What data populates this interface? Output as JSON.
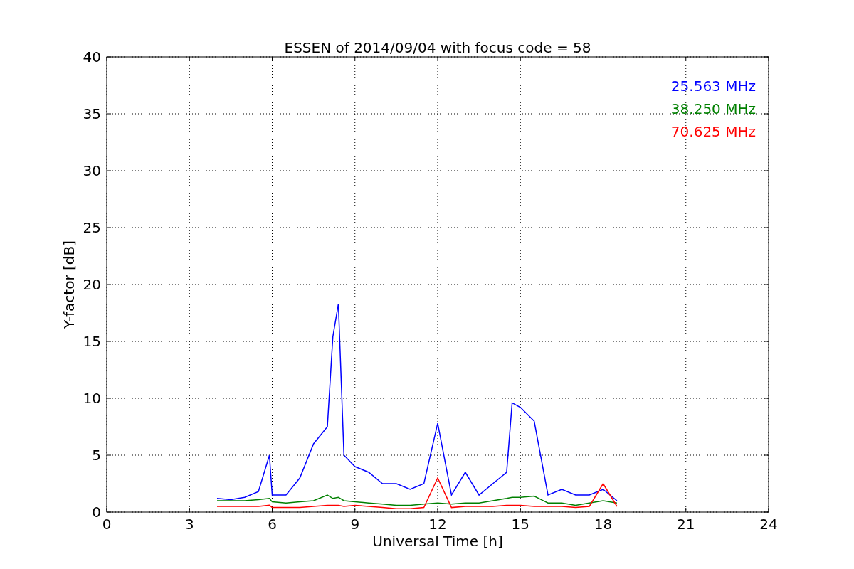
{
  "chart_data": {
    "type": "line",
    "title": "ESSEN of 2014/09/04 with focus code = 58",
    "xlabel": "Universal Time [h]",
    "ylabel": "Y-factor [dB]",
    "x": [
      4,
      4.5,
      5,
      5.5,
      5.9,
      6,
      6.5,
      7,
      7.5,
      8,
      8.2,
      8.4,
      8.6,
      9,
      9.5,
      10,
      10.5,
      11,
      11.5,
      12,
      12.5,
      13,
      13.5,
      14,
      14.5,
      14.7,
      15,
      15.5,
      16,
      16.5,
      17,
      17.5,
      18,
      18.5
    ],
    "series": [
      {
        "name": "25.563 MHz",
        "color": "#0000ff",
        "values": [
          1.2,
          1.1,
          1.3,
          1.8,
          5.0,
          1.5,
          1.5,
          3.0,
          6.0,
          7.5,
          15.4,
          18.3,
          5.0,
          4.0,
          3.5,
          2.5,
          2.5,
          2.0,
          2.5,
          7.8,
          1.5,
          3.5,
          1.5,
          2.5,
          3.5,
          9.6,
          9.2,
          8.0,
          1.5,
          2.0,
          1.5,
          1.5,
          2.0,
          1.0
        ]
      },
      {
        "name": "38.250 MHz",
        "color": "#008000",
        "values": [
          1.0,
          1.0,
          1.0,
          1.1,
          1.2,
          0.9,
          0.8,
          0.9,
          1.0,
          1.5,
          1.2,
          1.3,
          1.0,
          0.9,
          0.8,
          0.7,
          0.6,
          0.6,
          0.7,
          0.8,
          0.7,
          0.8,
          0.8,
          1.0,
          1.2,
          1.3,
          1.3,
          1.4,
          0.8,
          0.8,
          0.6,
          0.8,
          1.0,
          0.8
        ]
      },
      {
        "name": "70.625 MHz",
        "color": "#ff0000",
        "values": [
          0.5,
          0.5,
          0.5,
          0.5,
          0.6,
          0.4,
          0.4,
          0.4,
          0.5,
          0.6,
          0.6,
          0.6,
          0.5,
          0.6,
          0.5,
          0.4,
          0.3,
          0.3,
          0.4,
          3.0,
          0.4,
          0.5,
          0.5,
          0.5,
          0.6,
          0.6,
          0.6,
          0.5,
          0.5,
          0.5,
          0.4,
          0.5,
          2.5,
          0.5
        ]
      }
    ],
    "grid": true,
    "xlim": [
      0,
      24
    ],
    "ylim": [
      0,
      40
    ],
    "xticks": [
      {
        "value": 0,
        "label": "0"
      },
      {
        "value": 3,
        "label": "3"
      },
      {
        "value": 6,
        "label": "6"
      },
      {
        "value": 9,
        "label": "9"
      },
      {
        "value": 12,
        "label": "12"
      },
      {
        "value": 15,
        "label": "15"
      },
      {
        "value": 18,
        "label": "18"
      },
      {
        "value": 21,
        "label": "21"
      },
      {
        "value": 24,
        "label": "24"
      }
    ],
    "yticks": [
      {
        "value": 0,
        "label": "0"
      },
      {
        "value": 5,
        "label": "5"
      },
      {
        "value": 10,
        "label": "10"
      },
      {
        "value": 15,
        "label": "15"
      },
      {
        "value": 20,
        "label": "20"
      },
      {
        "value": 25,
        "label": "25"
      },
      {
        "value": 30,
        "label": "30"
      },
      {
        "value": 35,
        "label": "35"
      },
      {
        "value": 40,
        "label": "40"
      }
    ]
  }
}
